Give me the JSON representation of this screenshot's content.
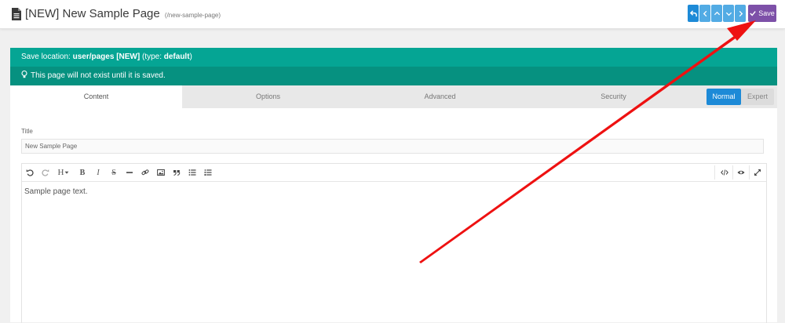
{
  "header": {
    "title": "[NEW] New Sample Page",
    "route": "(/new-sample-page)",
    "save_label": "Save",
    "icons": [
      "file-icon",
      "back-icon",
      "chevron-left-icon",
      "chevron-up-icon",
      "chevron-down-icon",
      "chevron-right-icon",
      "check-icon"
    ]
  },
  "notice": {
    "save_prefix": "Save location: ",
    "save_path": "user/pages [NEW]",
    "type_prefix": " (type: ",
    "type_value": "default",
    "type_suffix": ")",
    "not_exist": "This page will not exist until it is saved."
  },
  "tabs": [
    {
      "label": "Content",
      "active": true
    },
    {
      "label": "Options",
      "active": false
    },
    {
      "label": "Advanced",
      "active": false
    },
    {
      "label": "Security",
      "active": false
    }
  ],
  "mode": {
    "normal": "Normal",
    "expert": "Expert"
  },
  "form": {
    "title_label": "Title",
    "title_value": "New Sample Page"
  },
  "editor": {
    "content": "Sample page text.",
    "heading_label": "H"
  },
  "colors": {
    "notice_top": "#05a594",
    "notice_bottom": "#069180",
    "primary": "#1d8ad7",
    "save": "#7d50a8",
    "annotation_arrow": "#ee1111"
  }
}
